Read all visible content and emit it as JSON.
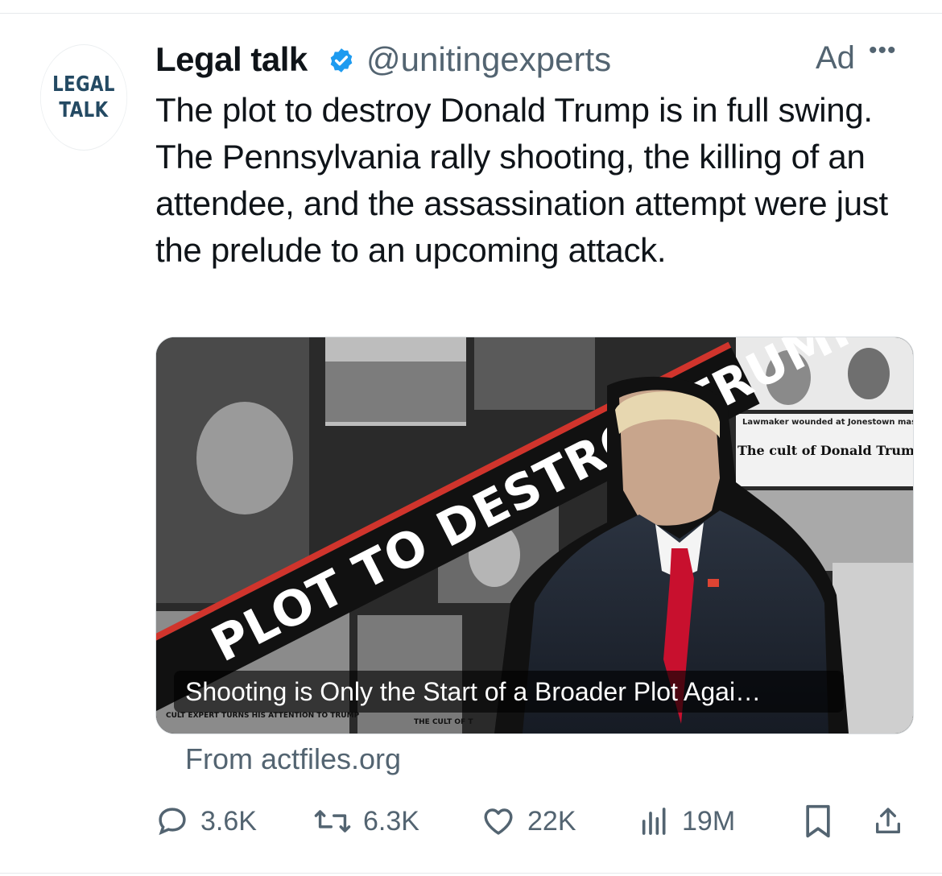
{
  "account": {
    "avatar_line1": "LEGAL",
    "avatar_line2": "TALK",
    "name": "Legal talk",
    "handle": "@unitingexperts",
    "ad_label": "Ad",
    "more": "•••"
  },
  "tweet": {
    "text": "The plot to destroy Donald Trump is in full swing. The Pennsylvania rally shooting, the killing of an attendee, and the assassination attempt were just the prelude to an upcoming attack."
  },
  "media": {
    "banner_text": "PLOT TO DESTROY TRUMP",
    "headline_1": "Lawmaker wounded at Jonestown massacre compares Trump to cult leader",
    "headline_2": "The cult of Donald Trump",
    "headline_3": "CULT EXPERT TURNS HIS ATTENTION TO TRUMP",
    "headline_4": "THE CULT OF T",
    "caption": "Shooting is Only the Start of a Broader Plot Agai…",
    "source": "From actfiles.org"
  },
  "actions": {
    "replies": "3.6K",
    "retweets": "6.3K",
    "likes": "22K",
    "views": "19M"
  },
  "icons": [
    "verified-badge-icon",
    "more-icon",
    "reply-icon",
    "retweet-icon",
    "like-icon",
    "views-icon",
    "bookmark-icon",
    "share-icon"
  ],
  "colors": {
    "verified": "#1d9bf0",
    "secondary_text": "#536471",
    "banner_stripe": "#d0342c",
    "tie": "#c8102e"
  }
}
